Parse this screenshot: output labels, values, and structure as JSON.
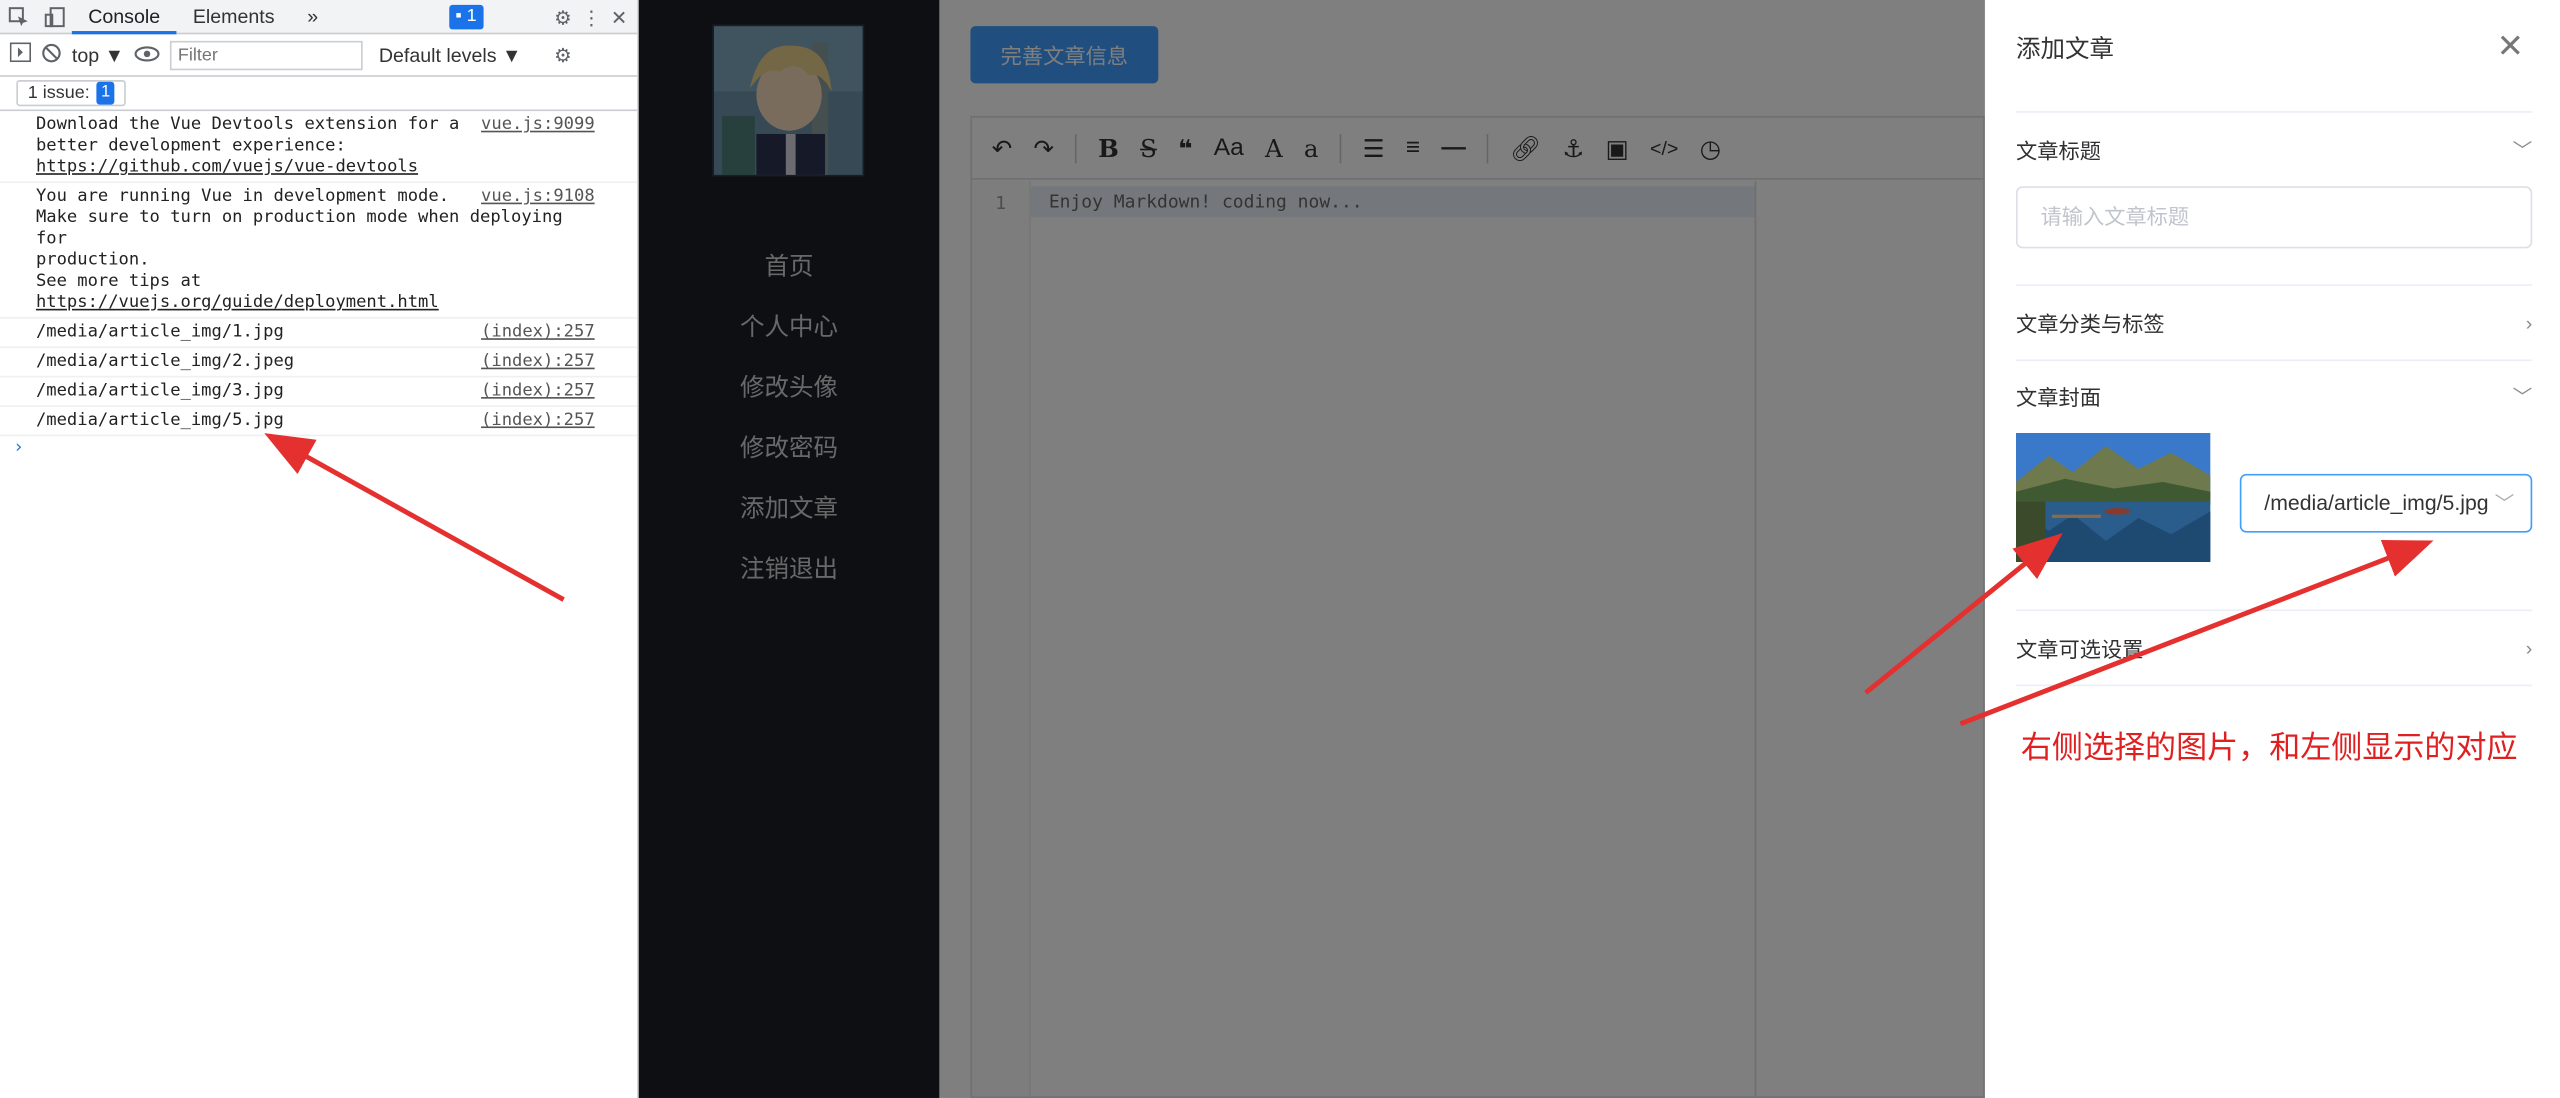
{
  "devtools": {
    "tabs": [
      "Console",
      "Elements"
    ],
    "more_tabs": "»",
    "badge_count": "1",
    "context": "top ▼",
    "filter_placeholder": "Filter",
    "levels": "Default levels ▼",
    "issues": "1 issue:",
    "issues_count": "1",
    "messages": [
      {
        "text_lines": [
          "Download the Vue Devtools extension for a",
          "better development experience:"
        ],
        "link": "https://github.com/vuejs/vue-devtools",
        "source": "vue.js:9099"
      },
      {
        "text_lines": [
          "You are running Vue in development mode.",
          "Make sure to turn on production mode when deploying for",
          "production."
        ],
        "tail": "See more tips at ",
        "link": "https://vuejs.org/guide/deployment.html",
        "source": "vue.js:9108"
      },
      {
        "text": "/media/article_img/1.jpg",
        "source": "(index):257"
      },
      {
        "text": "/media/article_img/2.jpeg",
        "source": "(index):257"
      },
      {
        "text": "/media/article_img/3.jpg",
        "source": "(index):257"
      },
      {
        "text": "/media/article_img/5.jpg",
        "source": "(index):257"
      }
    ],
    "prompt": "›"
  },
  "sidebar": {
    "nav": [
      "首页",
      "个人中心",
      "修改头像",
      "修改密码",
      "添加文章",
      "注销退出"
    ]
  },
  "main": {
    "complete_button": "完善文章信息",
    "editor_line_number": "1",
    "editor_placeholder": "Enjoy Markdown! coding now..."
  },
  "drawer": {
    "title": "添加文章",
    "close": "✕",
    "sections": {
      "title": "文章标题",
      "title_placeholder": "请输入文章标题",
      "category": "文章分类与标签",
      "cover": "文章封面",
      "cover_value": "/media/article_img/5.jpg",
      "options": "文章可选设置"
    }
  },
  "annotation": {
    "note": "右侧选择的图片，和左侧显示的对应",
    "color": "#e02020"
  }
}
